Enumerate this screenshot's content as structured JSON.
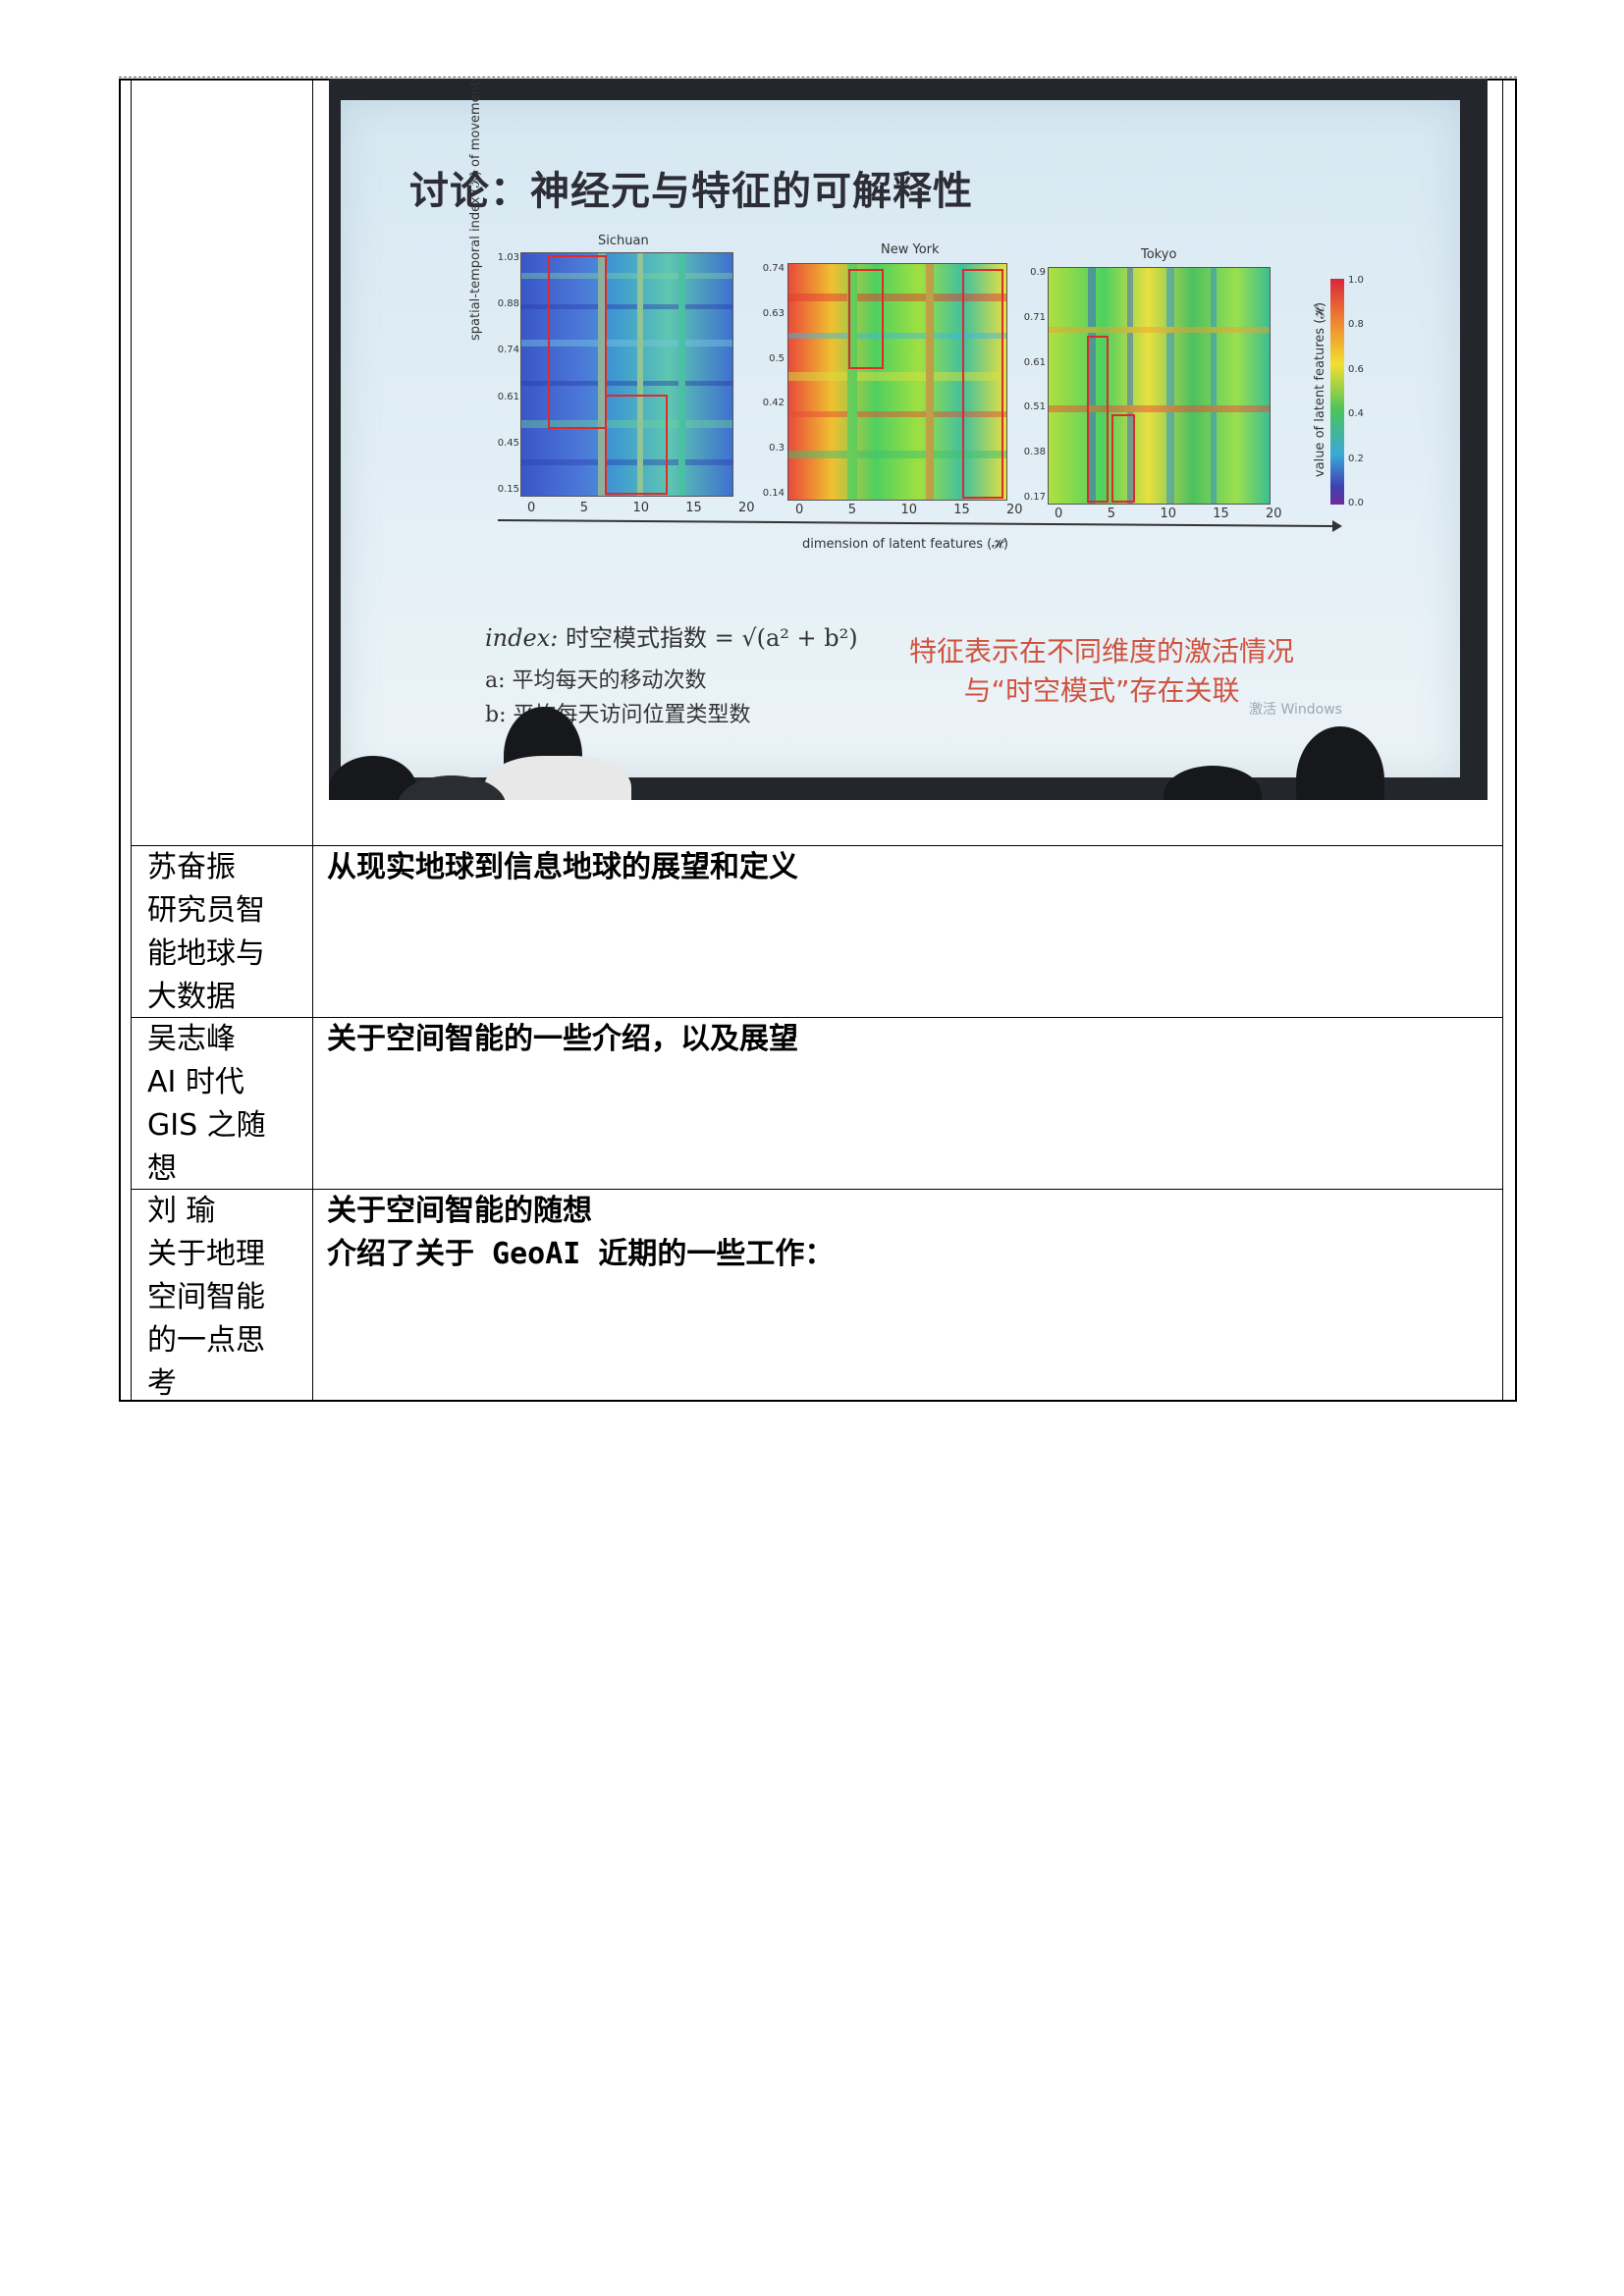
{
  "slide": {
    "title": "讨论：神经元与特征的可解释性",
    "panels": [
      {
        "name": "Sichuan",
        "y_ticks": [
          "1.03",
          "0.88",
          "0.74",
          "0.61",
          "0.45",
          "0.15"
        ],
        "x_ticks": [
          "0",
          "5",
          "10",
          "15",
          "20"
        ]
      },
      {
        "name": "New York",
        "y_ticks": [
          "0.74",
          "0.63",
          "0.5",
          "0.42",
          "0.3",
          "0.14"
        ],
        "x_ticks": [
          "0",
          "5",
          "10",
          "15",
          "20"
        ]
      },
      {
        "name": "Tokyo",
        "y_ticks": [
          "0.9",
          "0.71",
          "0.61",
          "0.51",
          "0.38",
          "0.17"
        ],
        "x_ticks": [
          "0",
          "5",
          "10",
          "15",
          "20"
        ]
      }
    ],
    "y_axis_label": "spatial-temporal index (𝒦) of movements",
    "x_axis_label": "dimension of latent features (𝓗)",
    "colorbar_label": "value of latent features (𝓗)",
    "colorbar_ticks": [
      "1.0",
      "0.8",
      "0.6",
      "0.4",
      "0.2",
      "0.0"
    ],
    "equation_prefix": "index:",
    "equation_text": "时空模式指数 = √(a² + b²)",
    "line_a": "a: 平均每天的移动次数",
    "line_b": "b: 平均每天访问位置类型数",
    "note_line1": "特征表示在不同维度的激活情况",
    "note_line2": "与“时空模式”存在关联",
    "watermark": "激活 Windows"
  },
  "rows": [
    {
      "left": [
        "苏奋振",
        "研究员智",
        "能地球与",
        "大数据"
      ],
      "right": [
        "从现实地球到信息地球的展望和定义"
      ]
    },
    {
      "left": [
        "吴志峰",
        "AI 时代",
        "GIS 之随",
        "想"
      ],
      "right": [
        "关于空间智能的一些介绍，以及展望"
      ]
    },
    {
      "left": [
        "刘 瑜",
        "关于地理",
        "空间智能",
        "的一点思",
        "考"
      ],
      "right": [
        "关于空间智能的随想",
        "介绍了关于 GeoAI 近期的一些工作："
      ]
    }
  ]
}
